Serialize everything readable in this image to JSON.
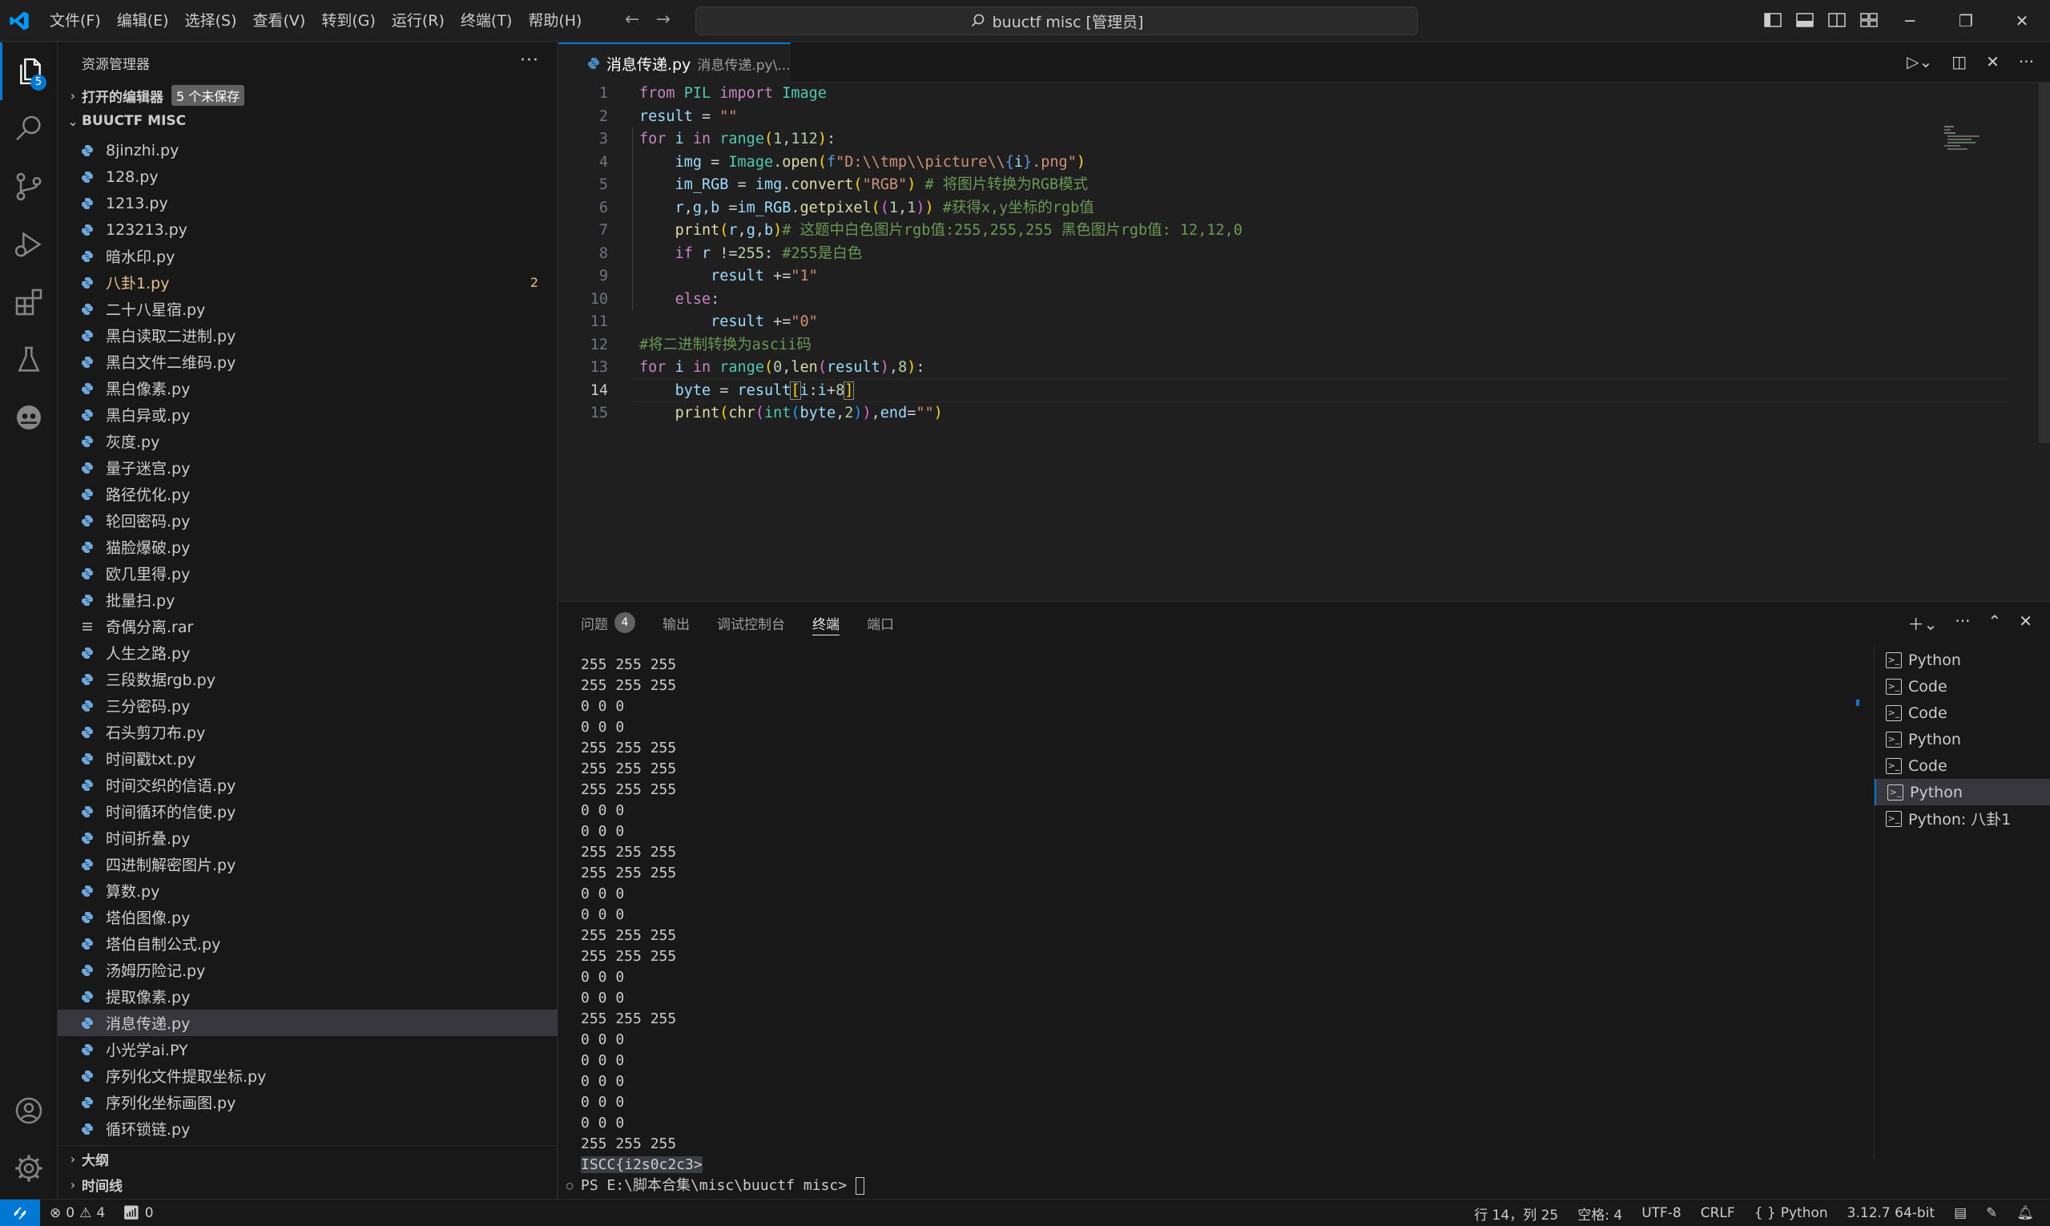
{
  "titlebar": {
    "menu": [
      "文件(F)",
      "编辑(E)",
      "选择(S)",
      "查看(V)",
      "转到(G)",
      "运行(R)",
      "终端(T)",
      "帮助(H)"
    ],
    "search": "buuctf misc [管理员]"
  },
  "activitybar": {
    "explorer_badge": "5"
  },
  "sidebar": {
    "title": "资源管理器",
    "open_editors": "打开的编辑器",
    "unsaved": "5 个未保存",
    "folder": "BUUCTF MISC",
    "files": [
      {
        "name": "8jinzhi.py"
      },
      {
        "name": "128.py"
      },
      {
        "name": "1213.py"
      },
      {
        "name": "123213.py"
      },
      {
        "name": "暗水印.py"
      },
      {
        "name": "八卦1.py",
        "count": "2"
      },
      {
        "name": "二十八星宿.py"
      },
      {
        "name": "黑白读取二进制.py"
      },
      {
        "name": "黑白文件二维码.py"
      },
      {
        "name": "黑白像素.py"
      },
      {
        "name": "黑白异或.py"
      },
      {
        "name": "灰度.py"
      },
      {
        "name": "量子迷宫.py"
      },
      {
        "name": "路径优化.py"
      },
      {
        "name": "轮回密码.py"
      },
      {
        "name": "猫脸爆破.py"
      },
      {
        "name": "欧几里得.py"
      },
      {
        "name": "批量扫.py"
      },
      {
        "name": "奇偶分离.rar"
      },
      {
        "name": "人生之路.py"
      },
      {
        "name": "三段数据rgb.py"
      },
      {
        "name": "三分密码.py"
      },
      {
        "name": "石头剪刀布.py"
      },
      {
        "name": "时间戳txt.py"
      },
      {
        "name": "时间交织的信语.py"
      },
      {
        "name": "时间循环的信使.py"
      },
      {
        "name": "时间折叠.py"
      },
      {
        "name": "四进制解密图片.py"
      },
      {
        "name": "算数.py"
      },
      {
        "name": "塔伯图像.py"
      },
      {
        "name": "塔伯自制公式.py"
      },
      {
        "name": "汤姆历险记.py"
      },
      {
        "name": "提取像素.py"
      },
      {
        "name": "消息传递.py"
      },
      {
        "name": "小光学ai.PY"
      },
      {
        "name": "序列化文件提取坐标.py"
      },
      {
        "name": "序列化坐标画图.py"
      },
      {
        "name": "循环锁链.py"
      }
    ],
    "outline": "大纲",
    "timeline": "时间线"
  },
  "editor": {
    "tab_name": "消息传递.py",
    "tab_desc": "消息传递.py\\...",
    "line_numbers": [
      "1",
      "2",
      "3",
      "4",
      "5",
      "6",
      "7",
      "8",
      "9",
      "10",
      "11",
      "12",
      "13",
      "14",
      "15"
    ]
  },
  "panel": {
    "tabs": [
      "问题",
      "输出",
      "调试控制台",
      "终端",
      "端口"
    ],
    "problems_count": "4",
    "terminal_lines": [
      "255 255 255",
      "255 255 255",
      "0 0 0",
      "0 0 0",
      "255 255 255",
      "255 255 255",
      "255 255 255",
      "0 0 0",
      "0 0 0",
      "255 255 255",
      "255 255 255",
      "0 0 0",
      "0 0 0",
      "255 255 255",
      "255 255 255",
      "0 0 0",
      "0 0 0",
      "255 255 255",
      "0 0 0",
      "0 0 0",
      "0 0 0",
      "0 0 0",
      "0 0 0",
      "255 255 255"
    ],
    "flag_line": "ISCC{i2s0c2c3>",
    "prompt": "PS E:\\脚本合集\\misc\\buuctf misc> ",
    "terminals": [
      "Python",
      "Code",
      "Code",
      "Python",
      "Code",
      "Python",
      "Python: 八卦1"
    ]
  },
  "statusbar": {
    "errors": "0",
    "warnings": "4",
    "ports": "0",
    "position": "行 14，列 25",
    "spaces": "空格: 4",
    "encoding": "UTF-8",
    "eol": "CRLF",
    "language": "Python",
    "interpreter": "3.12.7 64-bit"
  },
  "colors": {
    "accent": "#0078d4",
    "background": "#1f1f1f",
    "sidebar": "#181818"
  }
}
